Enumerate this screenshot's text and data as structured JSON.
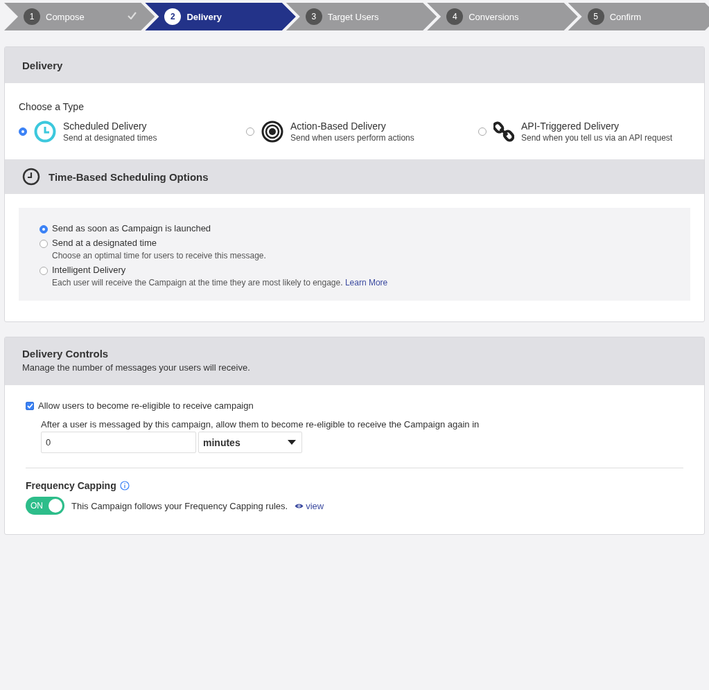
{
  "steps": [
    {
      "number": "1",
      "label": "Compose",
      "selected": false,
      "done": true
    },
    {
      "number": "2",
      "label": "Delivery",
      "selected": true,
      "done": false
    },
    {
      "number": "3",
      "label": "Target Users",
      "selected": false,
      "done": false
    },
    {
      "number": "4",
      "label": "Conversions",
      "selected": false,
      "done": false
    },
    {
      "number": "5",
      "label": "Confirm",
      "selected": false,
      "done": false
    }
  ],
  "delivery": {
    "title": "Delivery",
    "choose_label": "Choose a Type",
    "types": [
      {
        "kind": "clock",
        "title": "Scheduled Delivery",
        "description": "Send at designated times",
        "selected": true
      },
      {
        "kind": "target",
        "title": "Action-Based Delivery",
        "description": "Send when users perform actions",
        "selected": false
      },
      {
        "kind": "link",
        "title": "API-Triggered Delivery",
        "description": "Send when you tell us via an API request",
        "selected": false
      }
    ],
    "scheduling": {
      "title": "Time-Based Scheduling Options",
      "options": [
        {
          "label": "Send as soon as Campaign is launched",
          "selected": true
        },
        {
          "label": "Send at a designated time",
          "description": "Choose an optimal time for users to receive this message.",
          "selected": false
        },
        {
          "label": "Intelligent Delivery",
          "description": "Each user will receive the Campaign at the time they are most likely to engage.",
          "link": "Learn More",
          "selected": false
        }
      ]
    }
  },
  "controls": {
    "title": "Delivery Controls",
    "subtitle": "Manage the number of messages your users will receive.",
    "reeligible": {
      "label": "Allow users to become re-eligible to receive campaign",
      "checked": true,
      "hint": "After a user is messaged by this campaign, allow them to become re-eligible to receive the Campaign again in",
      "value": "0",
      "unit": "minutes"
    },
    "frequency": {
      "title": "Frequency Capping",
      "toggle_label": "ON",
      "on": true,
      "text": "This Campaign follows your Frequency Capping rules.",
      "link": "view"
    }
  }
}
